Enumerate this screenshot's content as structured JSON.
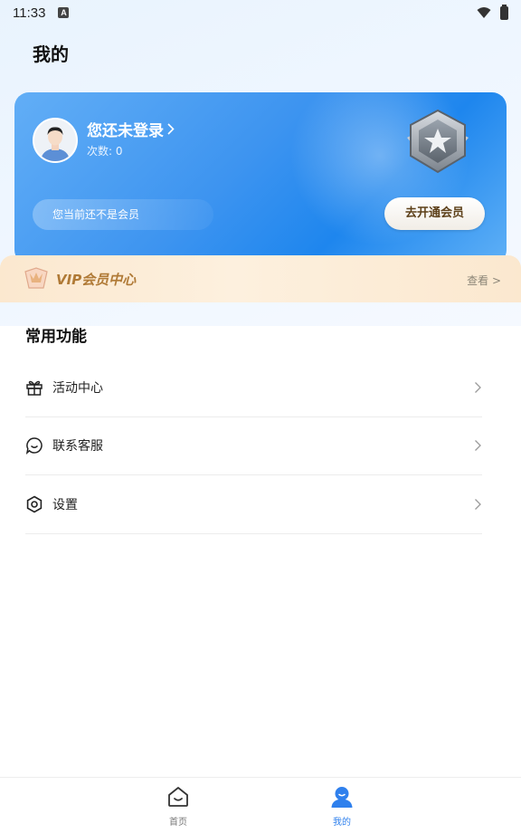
{
  "status_bar": {
    "time": "11:33",
    "notification_letter": "A"
  },
  "header": {
    "title": "我的"
  },
  "member_card": {
    "login_prompt": "您还未登录",
    "count_label": "次数: 0",
    "not_member_text": "您当前还不是会员",
    "open_button": "去开通会员"
  },
  "vip_strip": {
    "title": "VIP会员中心",
    "view_link": "查看 >"
  },
  "common_functions": {
    "title": "常用功能",
    "items": [
      {
        "label": "活动中心",
        "icon": "gift-icon"
      },
      {
        "label": "联系客服",
        "icon": "chat-icon"
      },
      {
        "label": "设置",
        "icon": "gear-icon"
      }
    ]
  },
  "tab_bar": {
    "tabs": [
      {
        "label": "首页",
        "icon": "home-icon",
        "active": false
      },
      {
        "label": "我的",
        "icon": "user-icon",
        "active": true
      }
    ]
  },
  "colors": {
    "accent": "#2f80ed",
    "gold": "#b07a36"
  }
}
